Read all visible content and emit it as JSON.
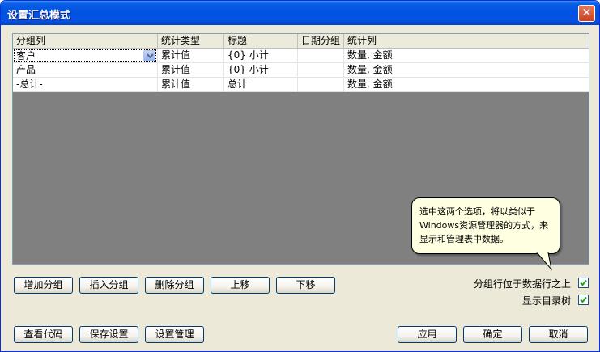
{
  "window": {
    "title": "设置汇总模式",
    "close_label": "✕"
  },
  "grid": {
    "columns": [
      "分组列",
      "统计类型",
      "标题",
      "日期分组",
      "统计列"
    ],
    "rows": [
      {
        "group": "客户",
        "stat_type": "累计值",
        "title": "{0} 小计",
        "date_group": "",
        "stat_cols": "数量, 金额"
      },
      {
        "group": "产品",
        "stat_type": "累计值",
        "title": "{0} 小计",
        "date_group": "",
        "stat_cols": "数量, 金额"
      },
      {
        "group": "-总计-",
        "stat_type": "累计值",
        "title": "总计",
        "date_group": "",
        "stat_cols": "数量, 金额"
      }
    ]
  },
  "tooltip": {
    "line1": "选中这两个选项，将以类似于",
    "line2": "Windows资源管理器的方式，来",
    "line3": "显示和管理表中数据。"
  },
  "row_buttons": {
    "add_group": "增加分组",
    "insert_group": "插入分组",
    "delete_group": "删除分组",
    "move_up": "上移",
    "move_down": "下移"
  },
  "options": {
    "group_row_above": {
      "label": "分组行位于数据行之上",
      "checked": true
    },
    "show_tree": {
      "label": "显示目录树",
      "checked": true
    }
  },
  "bottom_buttons": {
    "view_code": "查看代码",
    "save_settings": "保存设置",
    "manage_settings": "设置管理",
    "apply": "应用",
    "ok": "确定",
    "cancel": "取消"
  },
  "colors": {
    "titlebar": "#0052e0",
    "dialog_bg": "#ece9d8",
    "grid_empty": "#808080",
    "tooltip_bg": "#ffffe1",
    "checkmark": "#21a121"
  }
}
